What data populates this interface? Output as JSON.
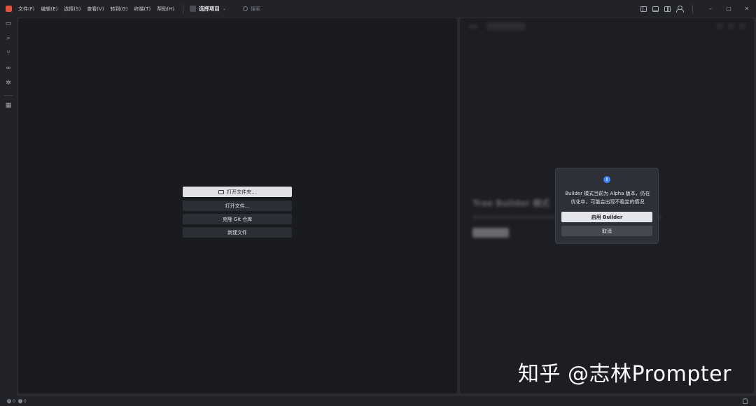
{
  "menu": [
    "文件(F)",
    "编辑(E)",
    "选择(S)",
    "查看(V)",
    "转到(G)",
    "终端(T)",
    "帮助(H)"
  ],
  "project": {
    "label": "选择项目"
  },
  "search": {
    "placeholder": "搜索"
  },
  "window_controls": {
    "minimize": "–",
    "restore": "▢",
    "close": "✕"
  },
  "editor": {
    "buttons": {
      "open_folder": "打开文件夹...",
      "open_file": "打开文件...",
      "clone_repo": "克隆 Git 仓库",
      "new_file": "新建文件"
    }
  },
  "builder": {
    "heading": "Trae Builder 模式"
  },
  "dialog": {
    "icon": "info-icon",
    "message_line1": "Builder 模式当前为 Alpha 版本，仍在",
    "message_line2": "优化中，可能会出现不稳定的情况",
    "confirm": "启用 Builder",
    "cancel": "取消"
  },
  "status": {
    "errors": "0",
    "warnings": "0"
  },
  "watermark": {
    "text": "知乎 @志林Prompter"
  },
  "colors": {
    "accent": "#3b82f6",
    "logo": "#e5533c"
  }
}
